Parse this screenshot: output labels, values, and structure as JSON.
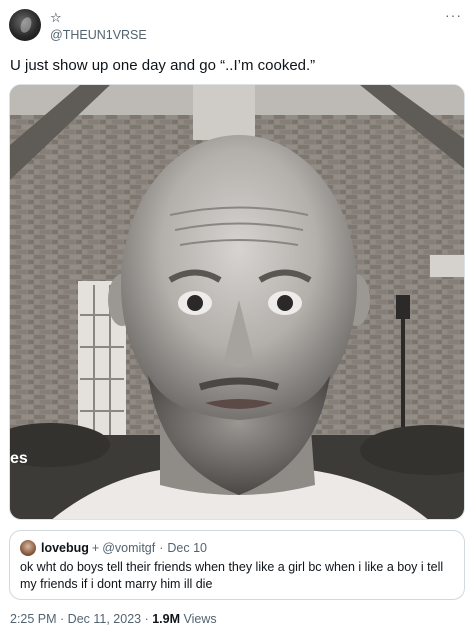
{
  "author": {
    "display_name": "☆",
    "handle": "@THEUN1VRSE",
    "more_label": "···"
  },
  "tweet": {
    "text": "U just show up one day and go “..I’m cooked.”"
  },
  "media": {
    "sign_text": "es"
  },
  "quote": {
    "display_name": "lovebug",
    "symbol": "+",
    "handle": "@vomitgf",
    "separator": "·",
    "date": "Dec 10",
    "text": "ok wht do boys tell their friends when they like a girl bc when i like a boy i tell my friends if i dont marry him ill die"
  },
  "meta": {
    "time": "2:25 PM",
    "sep1": " · ",
    "date": "Dec 11, 2023",
    "sep2": " · ",
    "views_count": "1.9M",
    "views_label": " Views"
  },
  "colors": {
    "text_primary": "#0f1419",
    "text_secondary": "#536471",
    "border": "#cfd9de"
  }
}
